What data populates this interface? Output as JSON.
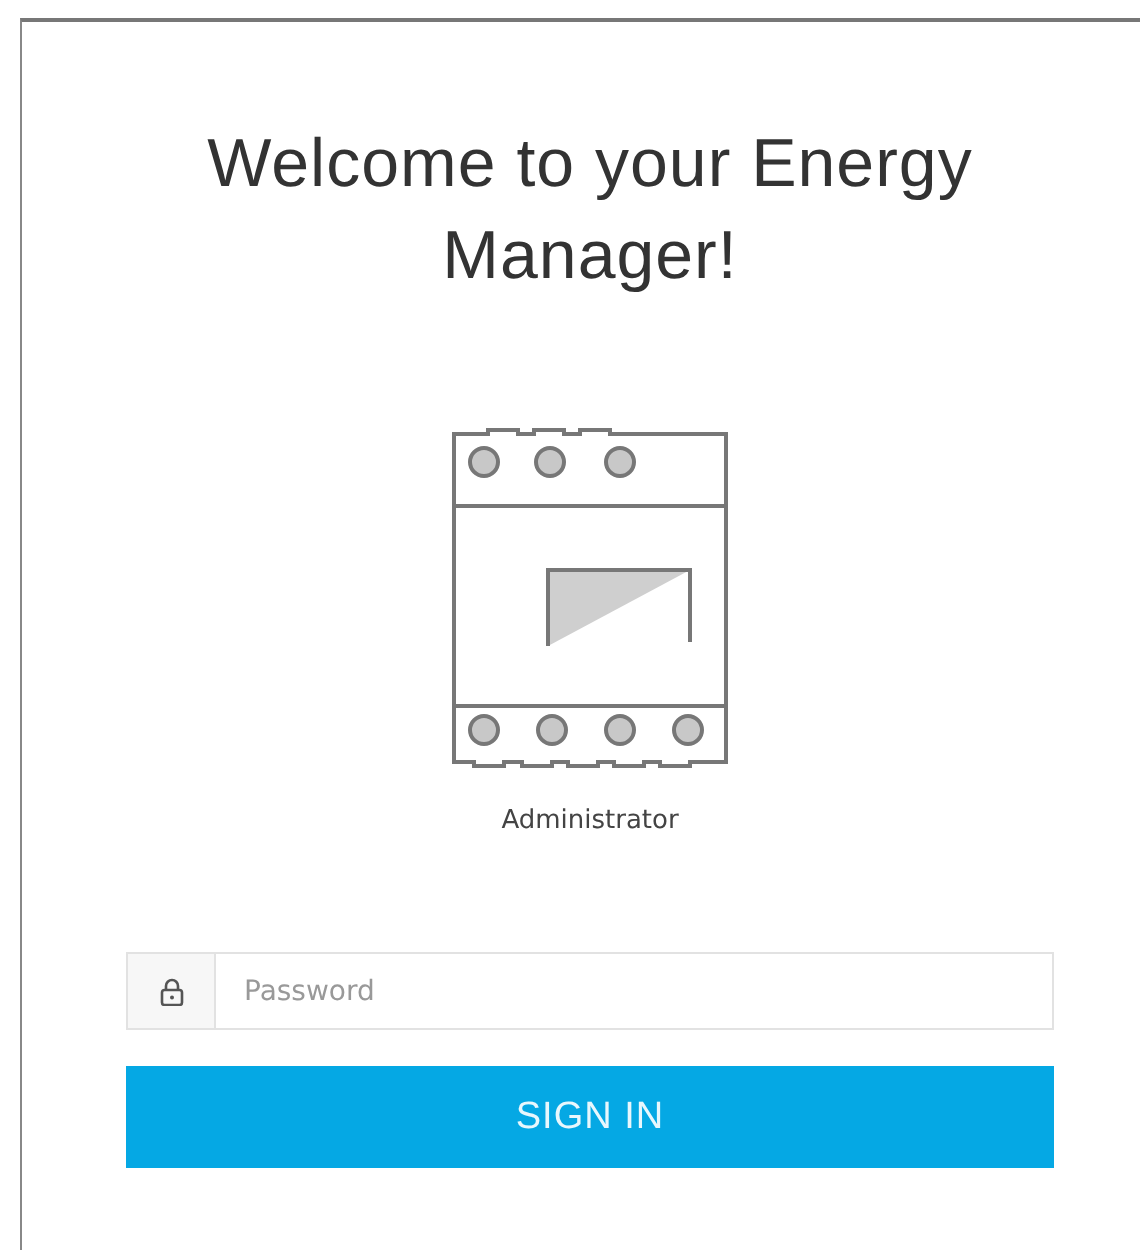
{
  "title": "Welcome to your Energy Manager!",
  "device": {
    "label": "Administrator"
  },
  "password": {
    "placeholder": "Password"
  },
  "button": {
    "label": "SIGN IN"
  }
}
